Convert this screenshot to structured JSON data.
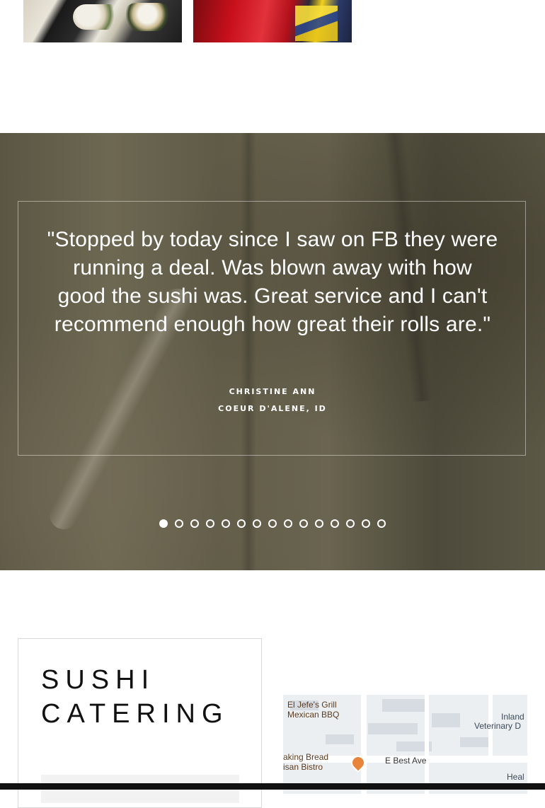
{
  "gallery": {
    "photos": [
      {
        "alt": "sushi-rolls-photo"
      },
      {
        "alt": "tuna-photo"
      }
    ]
  },
  "testimonial": {
    "quote": "\"Stopped by today since I saw on FB they were running a deal. Was blown away with how good the sushi was. Great service and I can't recommend enough how great their rolls are.\"",
    "author": "CHRISTINE ANN",
    "location": "COEUR D'ALENE, ID",
    "total_slides": 15,
    "active_slide": 1
  },
  "catering": {
    "title_line1": "SUSHI",
    "title_line2": "CATERING"
  },
  "map": {
    "labels": {
      "el_jefe_1": "El Jefe's Grill",
      "el_jefe_2": "Mexican BBQ",
      "inland_1": "Inland",
      "inland_2": "Veterinary D",
      "baking_1": "aking Bread",
      "baking_2": "isan Bistro",
      "street": "E Best Ave",
      "heal": "Heal"
    }
  },
  "colors": {
    "accent": "#e8853a",
    "text_dark": "#111111",
    "overlay_text": "#ffffff"
  }
}
